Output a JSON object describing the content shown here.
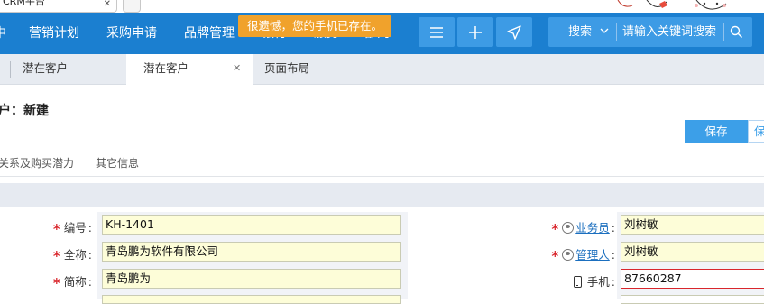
{
  "browser": {
    "tab_title": "CRM平台",
    "close_glyph": "✕"
  },
  "nav": {
    "items": [
      "营销计划",
      "采购申请",
      "品牌管理",
      "银行",
      "服务",
      "部门"
    ],
    "left_cut": "中",
    "search": {
      "scope": "搜索",
      "placeholder": "请输入关键词搜索"
    }
  },
  "toast": "很遗憾，您的手机已存在。",
  "page_tabs": [
    {
      "label": "潜在客户",
      "active": false
    },
    {
      "label": "潜在客户",
      "active": true,
      "close": "✕"
    },
    {
      "label": "页面布局",
      "active": false
    }
  ],
  "page": {
    "title": "户：新建",
    "save": "保存",
    "save2": "保",
    "subtabs": [
      "关系及购买潜力",
      "其它信息"
    ]
  },
  "form": {
    "left": [
      {
        "label": "编号",
        "value": "KH-1401",
        "required": true
      },
      {
        "label": "全称",
        "value": "青岛鹏为软件有限公司",
        "required": true
      },
      {
        "label": "简称",
        "value": "青岛鹏为",
        "required": true
      }
    ],
    "right": [
      {
        "label": "业务员",
        "value": "刘树敏",
        "required": true,
        "link": true
      },
      {
        "label": "管理人",
        "value": "刘树敏",
        "required": true,
        "link": true
      },
      {
        "label": "手机",
        "value": "87660287",
        "required": false,
        "error": true
      }
    ],
    "colon": ":"
  },
  "colors": {
    "nav": "#1b7fd0",
    "toast": "#f0a22c",
    "save": "#3c9fe8",
    "required": "#d9262c"
  }
}
